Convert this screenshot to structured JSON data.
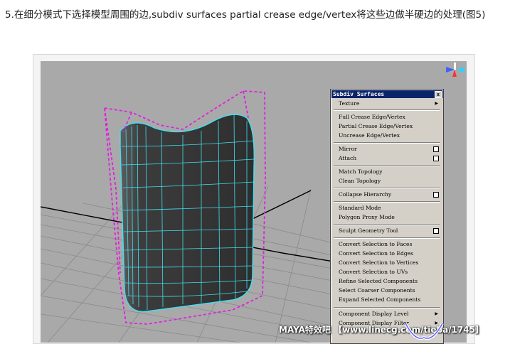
{
  "caption": "5.在细分模式下选择模型周围的边,subdiv surfaces partial crease edge/vertex将这些边做半硬边的处理(图5)",
  "menu": {
    "title": "Subdiv Surfaces",
    "close": "x",
    "items": [
      {
        "label": "Texture",
        "submenu": true
      },
      {
        "label": "Full Crease Edge/Vertex"
      },
      {
        "label": "Partial Crease Edge/Vertex"
      },
      {
        "label": "Uncrease Edge/Vertex"
      },
      {
        "label": "Mirror",
        "option": true
      },
      {
        "label": "Attach",
        "option": true
      },
      {
        "label": "Match Topology"
      },
      {
        "label": "Clean Topology"
      },
      {
        "label": "Collapse Hierarchy",
        "option": true
      },
      {
        "label": "Standard Mode"
      },
      {
        "label": "Polygon Proxy Mode"
      },
      {
        "label": "Sculpt Geometry Tool",
        "option": true
      },
      {
        "label": "Convert Selection to Faces"
      },
      {
        "label": "Convert Selection to Edges"
      },
      {
        "label": "Convert Selection to Vertices"
      },
      {
        "label": "Convert Selection to UVs"
      },
      {
        "label": "Refine Selected Components"
      },
      {
        "label": "Select Coarser Components"
      },
      {
        "label": "Expand Selected Components"
      },
      {
        "label": "Component Display Level",
        "submenu": true
      },
      {
        "label": "Component Display Filter",
        "submenu": true
      }
    ]
  },
  "watermark": "MAYA特效吧 【www.linecg.com/tieba/1745】",
  "colors": {
    "viewport_bg": "#a9a9a9",
    "wireframe": "#40e0f0",
    "selection_cage": "#e020e0",
    "menu_bg": "#d4d0c8",
    "menu_title_bg": "#0a246a"
  },
  "icons": [
    "view-axis-icon",
    "submenu-arrow-icon",
    "option-box-icon",
    "logo-icon"
  ]
}
